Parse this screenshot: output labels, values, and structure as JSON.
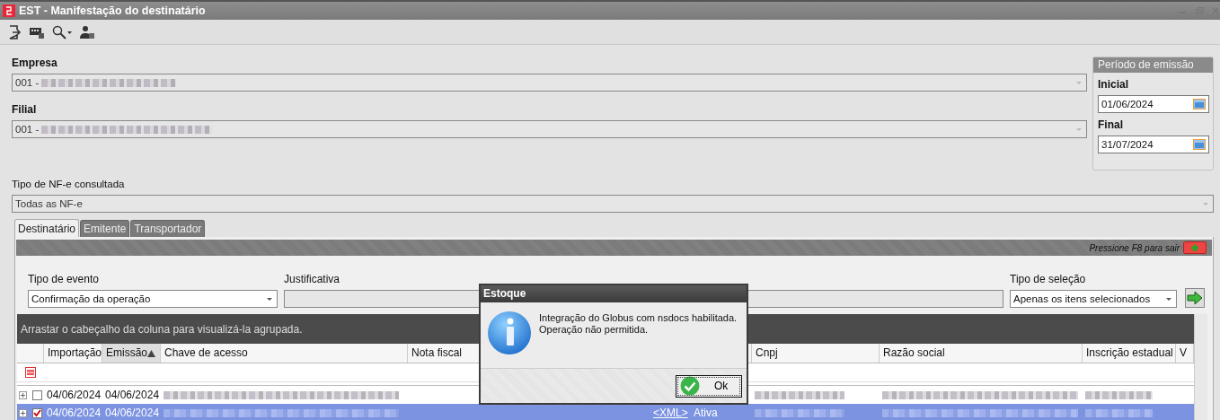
{
  "window": {
    "title": "EST - Manifestação do destinatário"
  },
  "toolbar": [
    {
      "kind": "exit"
    },
    {
      "kind": "keyboard"
    },
    {
      "kind": "search"
    },
    {
      "kind": "user"
    }
  ],
  "empresa": {
    "label": "Empresa",
    "value": "001 -"
  },
  "filial": {
    "label": "Filial",
    "value": "001 -"
  },
  "periodo": {
    "title": "Período de emissão",
    "inicial": {
      "label": "Inicial",
      "value": "01/06/2024"
    },
    "final": {
      "label": "Final",
      "value": "31/07/2024"
    }
  },
  "tipo_nfe": {
    "label": "Tipo de NF-e consultada",
    "value": "Todas as NF-e"
  },
  "tabs": [
    {
      "label": "Destinatário",
      "selected": true
    },
    {
      "label": "Emitente",
      "selected": false
    },
    {
      "label": "Transportador",
      "selected": false
    }
  ],
  "panel": {
    "hint": "Pressione F8 para sair"
  },
  "tipo_evento": {
    "label": "Tipo de evento",
    "value": "Confirmação da operação"
  },
  "justificativa": {
    "label": "Justificativa"
  },
  "tipo_selecao": {
    "label": "Tipo de seleção",
    "value": "Apenas os itens selecionados"
  },
  "grid": {
    "group_hint": "Arrastar o cabeçalho da coluna para visualizá-la agrupada.",
    "columns": [
      {
        "label": "Importação",
        "sorted": false
      },
      {
        "label": "Emissão",
        "sorted": true
      },
      {
        "label": "Chave de acesso",
        "sorted": false
      },
      {
        "label": "Nota fiscal",
        "sorted": false
      },
      {
        "label": "Cnpj",
        "sorted": false
      },
      {
        "label": "Razão social",
        "sorted": false
      },
      {
        "label": "Inscrição estadual",
        "sorted": false
      },
      {
        "label": "V",
        "sorted": false
      }
    ],
    "rows": [
      {
        "checked": false,
        "selected": false,
        "importacao": "04/06/2024",
        "emissao": "04/06/2024"
      },
      {
        "checked": true,
        "selected": true,
        "importacao": "04/06/2024",
        "emissao": "04/06/2024",
        "xml": "<XML>",
        "situacao": "Ativa"
      }
    ]
  },
  "dialog": {
    "title": "Estoque",
    "message": "Integração do Globus com nsdocs habilitada.\nOperação não permitida.",
    "button": "Ok"
  }
}
